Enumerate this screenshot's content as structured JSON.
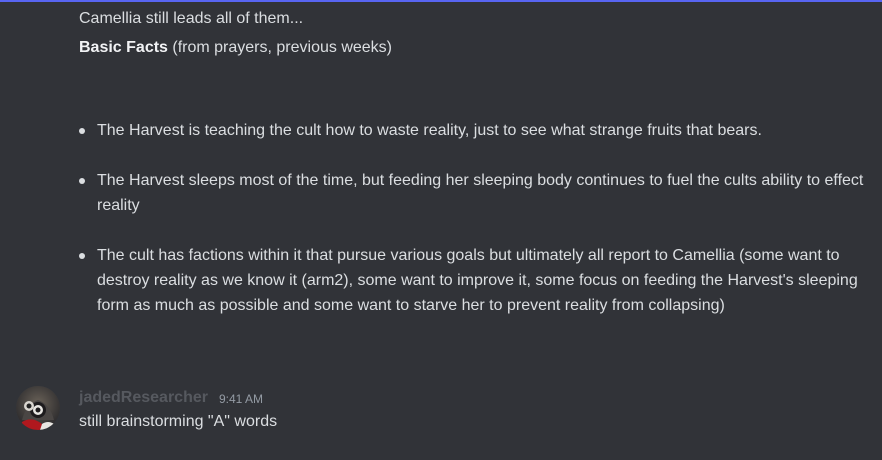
{
  "colors": {
    "background": "#313338",
    "accent": "#5865f2",
    "text": "#dbdee1",
    "username": "#56595f",
    "timestamp": "#949ba4"
  },
  "message1": {
    "line1": "Camellia still leads all of them...",
    "line2_bold": "Basic Facts",
    "line2_rest": " (from prayers, previous weeks)",
    "facts": [
      "The Harvest is teaching the cult how to waste reality, just to see what strange fruits that bears.",
      "The Harvest sleeps most of the time, but feeding her sleeping body continues to fuel the cults ability to effect reality",
      "The cult has factions within it that pursue various goals but ultimately all report to Camellia (some want to destroy reality as we know it (arm2), some want to improve it, some focus on feeding the Harvest's sleeping form as much as possible and some want to starve her to prevent reality from collapsing)"
    ]
  },
  "message2": {
    "username": "jadedResearcher",
    "timestamp": "9:41 AM",
    "text": "still brainstorming \"A\" words",
    "avatar_icon": "avatar-icon"
  }
}
